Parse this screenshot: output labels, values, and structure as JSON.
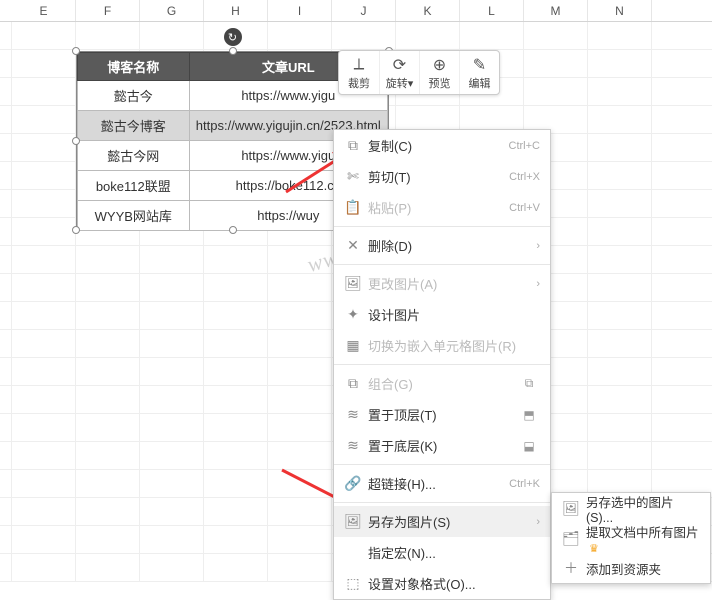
{
  "columns": [
    "E",
    "F",
    "G",
    "H",
    "I",
    "J",
    "K",
    "L",
    "M",
    "N"
  ],
  "table": {
    "headers": [
      "博客名称",
      "文章URL"
    ],
    "rows": [
      {
        "name": "懿古今",
        "url": "https://www.yigu"
      },
      {
        "name": "懿古今博客",
        "url": "https://www.yigujin.cn/2523.html",
        "hl": true
      },
      {
        "name": "懿古今网",
        "url": "https://www.yigu"
      },
      {
        "name": "boke112联盟",
        "url": "https://boke112.co"
      },
      {
        "name": "WYYB网站库",
        "url": "https://wuy"
      }
    ]
  },
  "minitb": [
    {
      "icon": "crop",
      "label": "裁剪"
    },
    {
      "icon": "rotate",
      "label": "旋转",
      "sub": "▾"
    },
    {
      "icon": "preview",
      "label": "预览"
    },
    {
      "icon": "edit",
      "label": "编辑"
    }
  ],
  "ctx": {
    "copy": {
      "label": "复制(C)",
      "short": "Ctrl+C"
    },
    "cut": {
      "label": "剪切(T)",
      "short": "Ctrl+X"
    },
    "paste": {
      "label": "粘贴(P)",
      "short": "Ctrl+V"
    },
    "delete": {
      "label": "删除(D)"
    },
    "change_img": {
      "label": "更改图片(A)"
    },
    "design_img": {
      "label": "设计图片"
    },
    "embed_cell": {
      "label": "切换为嵌入单元格图片(R)"
    },
    "group": {
      "label": "组合(G)"
    },
    "bring_top": {
      "label": "置于顶层(T)"
    },
    "send_bottom": {
      "label": "置于底层(K)"
    },
    "hyperlink": {
      "label": "超链接(H)...",
      "short": "Ctrl+K"
    },
    "save_as_img": {
      "label": "另存为图片(S)"
    },
    "assign_macro": {
      "label": "指定宏(N)..."
    },
    "format_obj": {
      "label": "设置对象格式(O)..."
    }
  },
  "submenu": {
    "save_selected": {
      "label": "另存选中的图片(S)..."
    },
    "extract_all": {
      "label": "提取文档中所有图片"
    },
    "add_resource": {
      "label": "添加到资源夹"
    }
  },
  "watermark": "www.yigujin.cn"
}
